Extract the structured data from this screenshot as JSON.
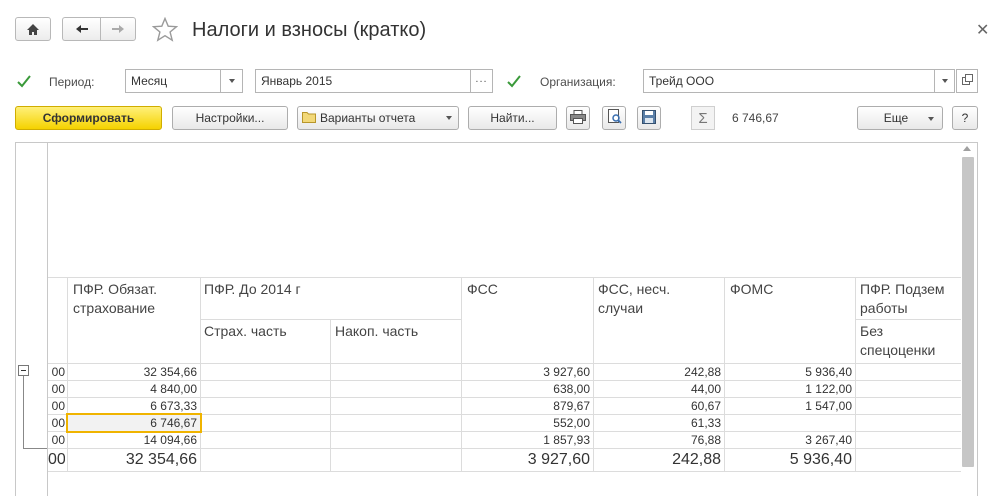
{
  "window": {
    "title": "Налоги и взносы (кратко)"
  },
  "filters": {
    "period_label": "Период:",
    "period_value": "Месяц",
    "month_value": "Январь 2015",
    "dots": "...",
    "org_label": "Организация:",
    "org_value": "Трейд ООО"
  },
  "toolbar": {
    "generate_label": "Сформировать",
    "settings_label": "Настройки...",
    "variants_label": "Варианты отчета",
    "find_label": "Найти...",
    "sum_value": "6 746,67",
    "more_label": "Еще",
    "help_label": "?"
  },
  "table": {
    "headers": {
      "pfr_obyaz": "ПФР. Обязат. страхование",
      "pfr_do2014": "ПФР. До 2014 г",
      "strah": "Страх. часть",
      "nakop": "Накоп. часть",
      "fss": "ФСС",
      "fss_nesch": "ФСС, несч. случаи",
      "foms": "ФОМС",
      "pfr_podzem": "ПФР. Подзем работы",
      "bez_spec": "Без спецоценки"
    },
    "rows": [
      {
        "first": "00",
        "pfr": "32 354,66",
        "fss": "3 927,60",
        "fss_n": "242,88",
        "foms": "5 936,40"
      },
      {
        "first": "00",
        "pfr": "4 840,00",
        "fss": "638,00",
        "fss_n": "44,00",
        "foms": "1 122,00"
      },
      {
        "first": "00",
        "pfr": "6 673,33",
        "fss": "879,67",
        "fss_n": "60,67",
        "foms": "1 547,00"
      },
      {
        "first": "00",
        "pfr": "6 746,67",
        "fss": "552,00",
        "fss_n": "61,33",
        "foms": ""
      },
      {
        "first": "00",
        "pfr": "14 094,66",
        "fss": "1 857,93",
        "fss_n": "76,88",
        "foms": "3 267,40"
      }
    ],
    "total": {
      "first": "00",
      "pfr": "32 354,66",
      "fss": "3 927,60",
      "fss_n": "242,88",
      "foms": "5 936,40"
    }
  },
  "colors": {
    "accent_yellow": "#f5d200",
    "check_green": "#3a9a3a",
    "selection_border": "#f0b400"
  }
}
